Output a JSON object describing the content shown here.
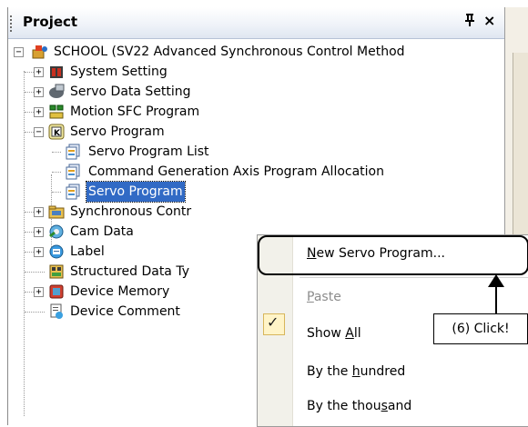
{
  "panel": {
    "title": "Project",
    "pin_glyph": "ᵖ",
    "close_glyph": "×"
  },
  "tree": {
    "root": "SCHOOL (SV22 Advanced Synchronous Control Method",
    "items": [
      {
        "label": "System Setting",
        "icon": "system-setting-icon"
      },
      {
        "label": "Servo Data Setting",
        "icon": "servo-data-icon"
      },
      {
        "label": "Motion SFC Program",
        "icon": "sfc-program-icon"
      },
      {
        "label": "Servo Program",
        "icon": "servo-program-folder-icon"
      },
      {
        "label": "Servo Program List",
        "icon": "program-list-icon"
      },
      {
        "label": "Command Generation Axis Program Allocation",
        "icon": "allocation-icon"
      },
      {
        "label": "Servo Program",
        "icon": "servo-program-file-icon"
      },
      {
        "label": "Synchronous Contr",
        "icon": "synchronous-control-icon"
      },
      {
        "label": "Cam Data",
        "icon": "cam-data-icon"
      },
      {
        "label": "Label",
        "icon": "label-icon"
      },
      {
        "label": "Structured Data Ty",
        "icon": "structured-data-icon"
      },
      {
        "label": "Device Memory",
        "icon": "device-memory-icon"
      },
      {
        "label": "Device Comment",
        "icon": "device-comment-icon"
      }
    ]
  },
  "context_menu": {
    "items": [
      {
        "label": "New Servo Program...",
        "mnemonic": "N",
        "rest": "ew Servo Program...",
        "enabled": true
      },
      {
        "label": "Paste",
        "mnemonic": "P",
        "rest": "aste",
        "enabled": false
      },
      {
        "label": "Show All",
        "pre": "Show ",
        "mnemonic": "A",
        "rest": "ll",
        "checked": true
      },
      {
        "label": "By the hundred",
        "pre": "By the ",
        "mnemonic": "h",
        "rest": "undred"
      },
      {
        "label": "By the thousand",
        "pre": "By the thou",
        "mnemonic": "s",
        "rest": "and"
      }
    ]
  },
  "annotation": {
    "callout": "(6) Click!"
  },
  "colors": {
    "title_gradient_end": "#dfe6f1",
    "selection": "#316ac5",
    "menu_gutter": "#f2f1ea",
    "check_bg": "#fff4c8"
  }
}
